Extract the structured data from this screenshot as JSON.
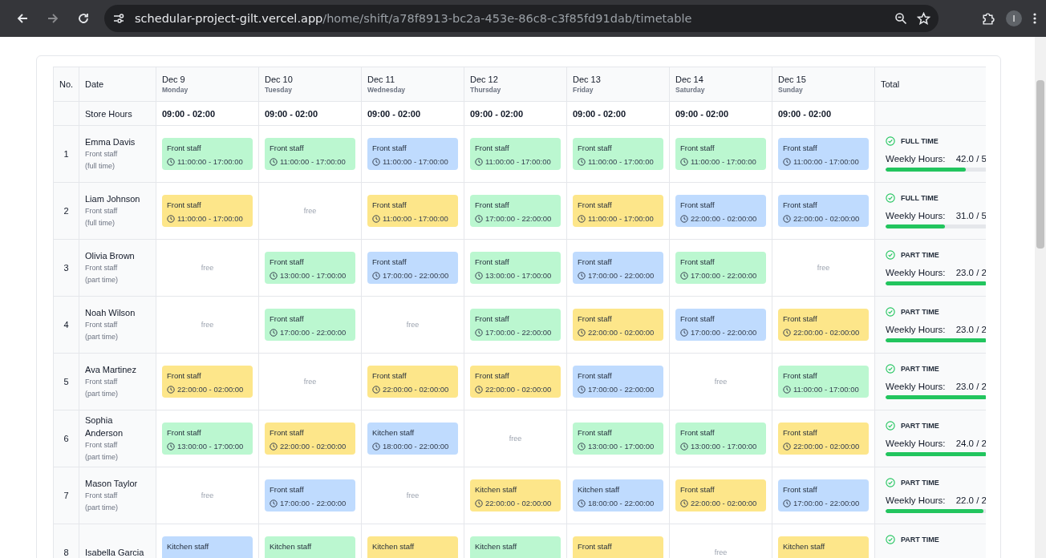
{
  "browser": {
    "url_host": "schedular-project-gilt.vercel.app",
    "url_path": "/home/shift/a78f8913-bc2a-453e-86c8-c3f85fd91dab/timetable",
    "profile_initial": "I"
  },
  "table": {
    "columns": {
      "no": "No.",
      "date": "Date",
      "total": "Total",
      "days": [
        {
          "date": "Dec 9",
          "weekday": "Monday"
        },
        {
          "date": "Dec 10",
          "weekday": "Tuesday"
        },
        {
          "date": "Dec 11",
          "weekday": "Wednesday"
        },
        {
          "date": "Dec 12",
          "weekday": "Thursday"
        },
        {
          "date": "Dec 13",
          "weekday": "Friday"
        },
        {
          "date": "Dec 14",
          "weekday": "Saturday"
        },
        {
          "date": "Dec 15",
          "weekday": "Sunday"
        }
      ]
    },
    "store_hours": {
      "label": "Store Hours",
      "values": [
        "09:00 - 02:00",
        "09:00 - 02:00",
        "09:00 - 02:00",
        "09:00 - 02:00",
        "09:00 - 02:00",
        "09:00 - 02:00",
        "09:00 - 02:00"
      ]
    },
    "rows": [
      {
        "no": "1",
        "name": "Emma Davis",
        "role": "Front staff",
        "contract": "(full time)",
        "shifts": [
          {
            "kind": "shift",
            "role": "Front staff",
            "time": "11:00:00 - 17:00:00",
            "color": "#bbf7d0"
          },
          {
            "kind": "shift",
            "role": "Front staff",
            "time": "11:00:00 - 17:00:00",
            "color": "#bbf7d0"
          },
          {
            "kind": "shift",
            "role": "Front staff",
            "time": "11:00:00 - 17:00:00",
            "color": "#bfdbfe"
          },
          {
            "kind": "shift",
            "role": "Front staff",
            "time": "11:00:00 - 17:00:00",
            "color": "#bbf7d0"
          },
          {
            "kind": "shift",
            "role": "Front staff",
            "time": "11:00:00 - 17:00:00",
            "color": "#bbf7d0"
          },
          {
            "kind": "shift",
            "role": "Front staff",
            "time": "11:00:00 - 17:00:00",
            "color": "#bbf7d0"
          },
          {
            "kind": "shift",
            "role": "Front staff",
            "time": "11:00:00 - 17:00:00",
            "color": "#bfdbfe"
          }
        ],
        "total": {
          "type": "FULL TIME",
          "hours_label": "Weekly Hours:",
          "hours": "42.0 / 5",
          "level": 0.79
        }
      },
      {
        "no": "2",
        "name": "Liam Johnson",
        "role": "Front staff",
        "contract": "(full time)",
        "shifts": [
          {
            "kind": "shift",
            "role": "Front staff",
            "time": "11:00:00 - 17:00:00",
            "color": "#fde68a"
          },
          {
            "kind": "free",
            "label": "free"
          },
          {
            "kind": "shift",
            "role": "Front staff",
            "time": "11:00:00 - 17:00:00",
            "color": "#fde68a"
          },
          {
            "kind": "shift",
            "role": "Front staff",
            "time": "17:00:00 - 22:00:00",
            "color": "#bbf7d0"
          },
          {
            "kind": "shift",
            "role": "Front staff",
            "time": "11:00:00 - 17:00:00",
            "color": "#fde68a"
          },
          {
            "kind": "shift",
            "role": "Front staff",
            "time": "22:00:00 - 02:00:00",
            "color": "#bfdbfe"
          },
          {
            "kind": "shift",
            "role": "Front staff",
            "time": "22:00:00 - 02:00:00",
            "color": "#bfdbfe"
          }
        ],
        "total": {
          "type": "FULL TIME",
          "hours_label": "Weekly Hours:",
          "hours": "31.0 / 5",
          "level": 0.59
        }
      },
      {
        "no": "3",
        "name": "Olivia Brown",
        "role": "Front staff",
        "contract": "(part time)",
        "shifts": [
          {
            "kind": "free",
            "label": "free"
          },
          {
            "kind": "shift",
            "role": "Front staff",
            "time": "13:00:00 - 17:00:00",
            "color": "#bbf7d0"
          },
          {
            "kind": "shift",
            "role": "Front staff",
            "time": "17:00:00 - 22:00:00",
            "color": "#bfdbfe"
          },
          {
            "kind": "shift",
            "role": "Front staff",
            "time": "13:00:00 - 17:00:00",
            "color": "#bbf7d0"
          },
          {
            "kind": "shift",
            "role": "Front staff",
            "time": "17:00:00 - 22:00:00",
            "color": "#bfdbfe"
          },
          {
            "kind": "shift",
            "role": "Front staff",
            "time": "17:00:00 - 22:00:00",
            "color": "#bbf7d0"
          },
          {
            "kind": "free",
            "label": "free"
          }
        ],
        "total": {
          "type": "PART TIME",
          "hours_label": "Weekly Hours:",
          "hours": "23.0 / 2",
          "level": 1
        }
      },
      {
        "no": "4",
        "name": "Noah Wilson",
        "role": "Front staff",
        "contract": "(part time)",
        "shifts": [
          {
            "kind": "free",
            "label": "free"
          },
          {
            "kind": "shift",
            "role": "Front staff",
            "time": "17:00:00 - 22:00:00",
            "color": "#bbf7d0"
          },
          {
            "kind": "free",
            "label": "free"
          },
          {
            "kind": "shift",
            "role": "Front staff",
            "time": "17:00:00 - 22:00:00",
            "color": "#bbf7d0"
          },
          {
            "kind": "shift",
            "role": "Front staff",
            "time": "22:00:00 - 02:00:00",
            "color": "#fde68a"
          },
          {
            "kind": "shift",
            "role": "Front staff",
            "time": "17:00:00 - 22:00:00",
            "color": "#bfdbfe"
          },
          {
            "kind": "shift",
            "role": "Front staff",
            "time": "22:00:00 - 02:00:00",
            "color": "#fde68a"
          }
        ],
        "total": {
          "type": "PART TIME",
          "hours_label": "Weekly Hours:",
          "hours": "23.0 / 2",
          "level": 1
        }
      },
      {
        "no": "5",
        "name": "Ava Martinez",
        "role": "Front staff",
        "contract": "(part time)",
        "shifts": [
          {
            "kind": "shift",
            "role": "Front staff",
            "time": "22:00:00 - 02:00:00",
            "color": "#fde68a"
          },
          {
            "kind": "free",
            "label": "free"
          },
          {
            "kind": "shift",
            "role": "Front staff",
            "time": "22:00:00 - 02:00:00",
            "color": "#fde68a"
          },
          {
            "kind": "shift",
            "role": "Front staff",
            "time": "22:00:00 - 02:00:00",
            "color": "#fde68a"
          },
          {
            "kind": "shift",
            "role": "Front staff",
            "time": "17:00:00 - 22:00:00",
            "color": "#bfdbfe"
          },
          {
            "kind": "free",
            "label": "free"
          },
          {
            "kind": "shift",
            "role": "Front staff",
            "time": "11:00:00 - 17:00:00",
            "color": "#bbf7d0"
          }
        ],
        "total": {
          "type": "PART TIME",
          "hours_label": "Weekly Hours:",
          "hours": "23.0 / 2",
          "level": 1
        }
      },
      {
        "no": "6",
        "name": "Sophia Anderson",
        "role": "Front staff",
        "contract": "(part time)",
        "shifts": [
          {
            "kind": "shift",
            "role": "Front staff",
            "time": "13:00:00 - 17:00:00",
            "color": "#bbf7d0"
          },
          {
            "kind": "shift",
            "role": "Front staff",
            "time": "22:00:00 - 02:00:00",
            "color": "#fde68a"
          },
          {
            "kind": "shift",
            "role": "Kitchen staff",
            "time": "18:00:00 - 22:00:00",
            "color": "#bfdbfe"
          },
          {
            "kind": "free",
            "label": "free"
          },
          {
            "kind": "shift",
            "role": "Front staff",
            "time": "13:00:00 - 17:00:00",
            "color": "#bbf7d0"
          },
          {
            "kind": "shift",
            "role": "Front staff",
            "time": "13:00:00 - 17:00:00",
            "color": "#bbf7d0"
          },
          {
            "kind": "shift",
            "role": "Front staff",
            "time": "22:00:00 - 02:00:00",
            "color": "#fde68a"
          }
        ],
        "total": {
          "type": "PART TIME",
          "hours_label": "Weekly Hours:",
          "hours": "24.0 / 2",
          "level": 1
        }
      },
      {
        "no": "7",
        "name": "Mason Taylor",
        "role": "Front staff",
        "contract": "(part time)",
        "shifts": [
          {
            "kind": "free",
            "label": "free"
          },
          {
            "kind": "shift",
            "role": "Front staff",
            "time": "17:00:00 - 22:00:00",
            "color": "#bfdbfe"
          },
          {
            "kind": "free",
            "label": "free"
          },
          {
            "kind": "shift",
            "role": "Kitchen staff",
            "time": "22:00:00 - 02:00:00",
            "color": "#fde68a"
          },
          {
            "kind": "shift",
            "role": "Kitchen staff",
            "time": "18:00:00 - 22:00:00",
            "color": "#bfdbfe"
          },
          {
            "kind": "shift",
            "role": "Front staff",
            "time": "22:00:00 - 02:00:00",
            "color": "#fde68a"
          },
          {
            "kind": "shift",
            "role": "Front staff",
            "time": "17:00:00 - 22:00:00",
            "color": "#bfdbfe"
          }
        ],
        "total": {
          "type": "PART TIME",
          "hours_label": "Weekly Hours:",
          "hours": "22.0 / 2",
          "level": 0.97
        }
      },
      {
        "no": "8",
        "name": "Isabella Garcia",
        "shifts": [
          {
            "kind": "shift",
            "role": "Kitchen staff",
            "color": "#bfdbfe"
          },
          {
            "kind": "shift",
            "role": "Kitchen staff",
            "color": "#bbf7d0"
          },
          {
            "kind": "shift",
            "role": "Kitchen staff",
            "color": "#fde68a"
          },
          {
            "kind": "shift",
            "role": "Kitchen staff",
            "color": "#bbf7d0"
          },
          {
            "kind": "shift",
            "role": "Front staff",
            "color": "#fde68a"
          },
          {
            "kind": "free",
            "label": "free"
          },
          {
            "kind": "shift",
            "role": "Kitchen staff",
            "color": "#fde68a"
          }
        ],
        "total": {
          "type": "PART TIME"
        }
      }
    ]
  }
}
